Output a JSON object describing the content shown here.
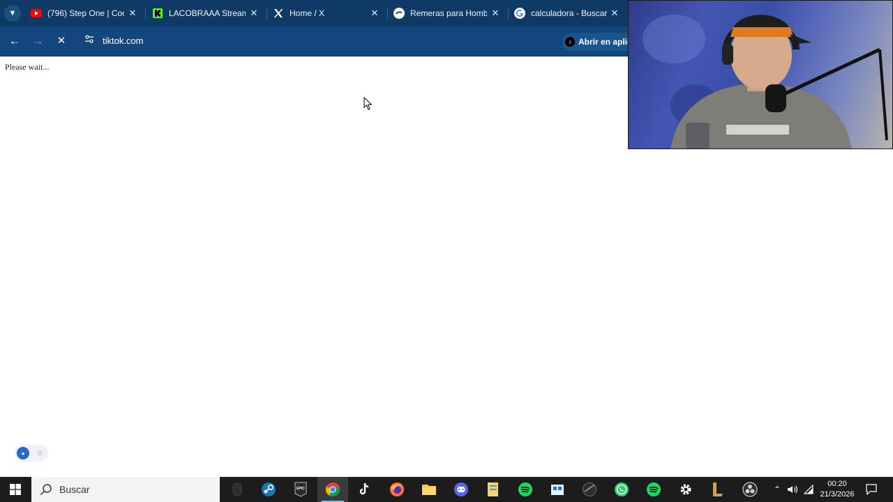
{
  "browser": {
    "tabs": [
      {
        "title": "(796) Step One | Coco",
        "icon": "youtube-icon"
      },
      {
        "title": "LACOBRAAA Stream",
        "icon": "kick-icon"
      },
      {
        "title": "Home / X",
        "icon": "x-icon"
      },
      {
        "title": "Remeras para Hombr",
        "icon": "store-icon"
      },
      {
        "title": "calculadora - Buscar",
        "icon": "google-icon"
      }
    ],
    "url": "tiktok.com",
    "open_app_label": "Abrir en aplic"
  },
  "page": {
    "message": "Please wait..."
  },
  "taskbar": {
    "search_placeholder": "Buscar",
    "time": "00:20",
    "date": "21/3/2026"
  },
  "colors": {
    "tabbar": "#0f3a66",
    "toolbar": "#12467c",
    "taskbar": "#1c1c1c"
  }
}
